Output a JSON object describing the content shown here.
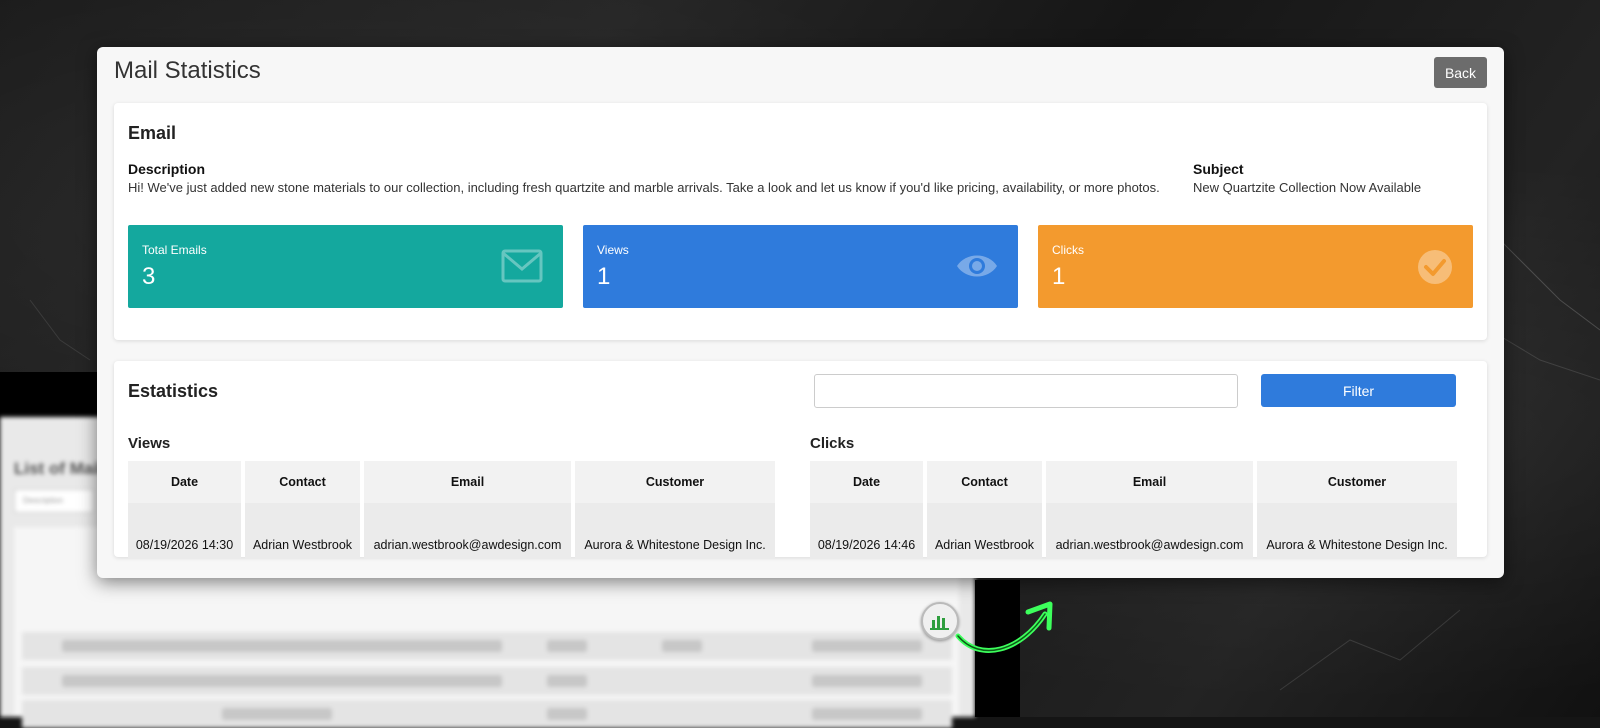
{
  "background": {
    "blurred_app_title": "List of Mail",
    "blurred_search_placeholder": "Description"
  },
  "modal": {
    "title": "Mail Statistics",
    "back_label": "Back"
  },
  "email_card": {
    "heading": "Email",
    "description_label": "Description",
    "description_text": "Hi! We've just added new stone materials to our collection, including fresh quartzite and marble arrivals. Take a look and let us know if you'd like pricing, availability, or more photos.",
    "subject_label": "Subject",
    "subject_text": "New Quartzite Collection Now Available"
  },
  "stats": [
    {
      "label": "Total Emails",
      "value": "3",
      "color": "#14a89e",
      "icon": "envelope-icon"
    },
    {
      "label": "Views",
      "value": "1",
      "color": "#2f7bdc",
      "icon": "eye-icon"
    },
    {
      "label": "Clicks",
      "value": "1",
      "color": "#f39a2e",
      "icon": "check-circle-icon"
    }
  ],
  "statistics_card": {
    "heading": "Estatistics",
    "filter_value": "",
    "filter_label": "Filter",
    "views": {
      "heading": "Views",
      "columns": [
        "Date",
        "Contact",
        "Email",
        "Customer"
      ],
      "rows": [
        [
          "08/19/2026 14:30",
          "Adrian Westbrook",
          "adrian.westbrook@awdesign.com",
          "Aurora & Whitestone Design Inc."
        ]
      ]
    },
    "clicks": {
      "heading": "Clicks",
      "columns": [
        "Date",
        "Contact",
        "Email",
        "Customer"
      ],
      "rows": [
        [
          "08/19/2026 14:46",
          "Adrian Westbrook",
          "adrian.westbrook@awdesign.com",
          "Aurora & Whitestone Design Inc."
        ]
      ]
    }
  }
}
